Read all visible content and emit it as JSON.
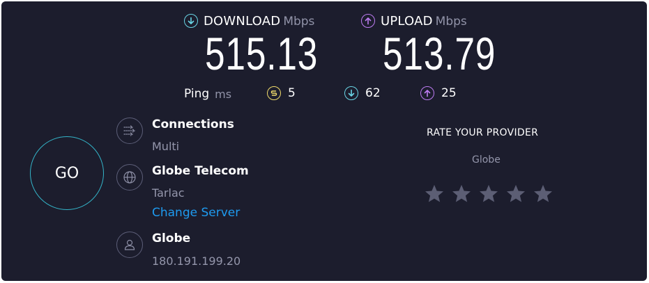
{
  "download": {
    "label": "DOWNLOAD",
    "unit": "Mbps",
    "value": "515.13"
  },
  "upload": {
    "label": "UPLOAD",
    "unit": "Mbps",
    "value": "513.79"
  },
  "ping": {
    "label": "Ping",
    "unit": "ms",
    "idle": "5",
    "download": "62",
    "upload": "25"
  },
  "go_label": "GO",
  "connections": {
    "title": "Connections",
    "value": "Multi"
  },
  "server": {
    "title": "Globe Telecom",
    "location": "Tarlac",
    "change_label": "Change Server"
  },
  "provider": {
    "title": "Globe",
    "ip": "180.191.199.20"
  },
  "rate": {
    "title": "RATE YOUR PROVIDER",
    "provider": "Globe",
    "rating": 0,
    "max": 5
  },
  "colors": {
    "background": "#1c1d2d",
    "download_accent": "#6ad6e6",
    "upload_accent": "#bd7cf2",
    "ping_accent": "#f2dc6b",
    "go_ring": "#34b5c9",
    "link": "#1e9bf0",
    "star": "#5c5e74"
  },
  "icons": {
    "download": "arrow-down-circle-icon",
    "upload": "arrow-up-circle-icon",
    "ping": "ping-icon",
    "connections": "connections-icon",
    "server": "globe-icon",
    "provider": "user-icon",
    "rating": "star-icon"
  }
}
